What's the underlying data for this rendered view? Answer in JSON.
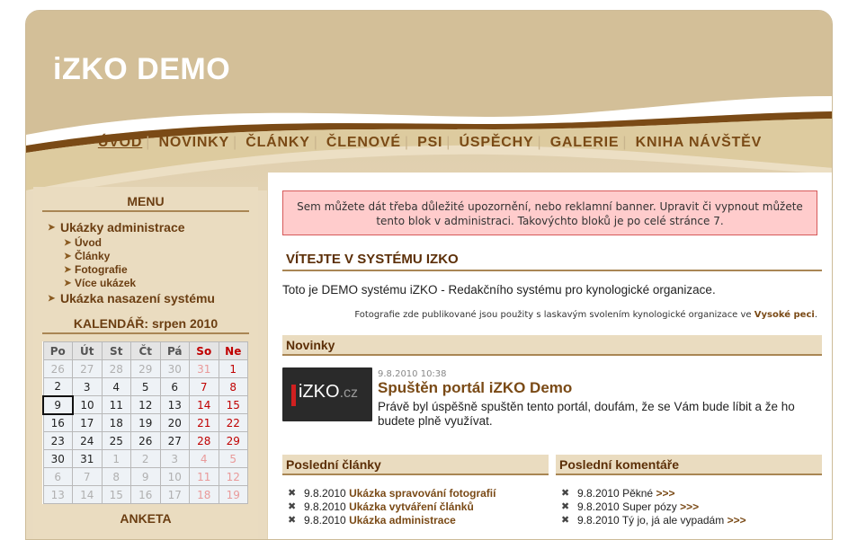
{
  "site": {
    "title": "iZKO DEMO"
  },
  "nav": [
    {
      "label": "ÚVOD",
      "active": true
    },
    {
      "label": "NOVINKY"
    },
    {
      "label": "ČLÁNKY"
    },
    {
      "label": "ČLENOVÉ"
    },
    {
      "label": "PSI"
    },
    {
      "label": "ÚSPĚCHY"
    },
    {
      "label": "GALERIE"
    },
    {
      "label": "KNIHA NÁVŠTĚV"
    }
  ],
  "sidebar": {
    "menu_heading": "MENU",
    "menu": [
      {
        "label": "Ukázky administrace",
        "children": [
          "Úvod",
          "Články",
          "Fotografie",
          "Více ukázek"
        ]
      },
      {
        "label": "Ukázka nasazení systému",
        "children": []
      }
    ],
    "calendar": {
      "heading": "KALENDÁŘ: srpen 2010",
      "days": [
        "Po",
        "Út",
        "St",
        "Čt",
        "Pá",
        "So",
        "Ne"
      ],
      "weeks": [
        [
          "26",
          "27",
          "28",
          "29",
          "30",
          "31",
          "1"
        ],
        [
          "2",
          "3",
          "4",
          "5",
          "6",
          "7",
          "8"
        ],
        [
          "9",
          "10",
          "11",
          "12",
          "13",
          "14",
          "15"
        ],
        [
          "16",
          "17",
          "18",
          "19",
          "20",
          "21",
          "22"
        ],
        [
          "23",
          "24",
          "25",
          "26",
          "27",
          "28",
          "29"
        ],
        [
          "30",
          "31",
          "1",
          "2",
          "3",
          "4",
          "5"
        ],
        [
          "6",
          "7",
          "8",
          "9",
          "10",
          "11",
          "12"
        ],
        [
          "13",
          "14",
          "15",
          "16",
          "17",
          "18",
          "19"
        ]
      ],
      "today": "9"
    },
    "poll_heading": "ANKETA"
  },
  "content": {
    "banner": "Sem můžete dát třeba důležité upozornění, nebo reklamní banner. Upravit či vypnout můžete tento blok v administraci. Takovýchto bloků je po celé stránce 7.",
    "welcome": "VÍTEJTE V SYSTÉMU IZKO",
    "intro": "Toto je DEMO systému iZKO - Redakčního systému pro kynologické organizace.",
    "credit_text": "Fotografie zde publikované jsou použity s laskavým svolením kynologické organizace ve",
    "credit_link": "Vysoké peci",
    "news": {
      "heading": "Novinky",
      "logo_main": "iZKO",
      "logo_suffix": ".cz",
      "date": "9.8.2010 10:38",
      "title": "Spuštěn portál iZKO Demo",
      "text": "Právě byl úspěšně spuštěn tento portál, doufám, že se Vám bude líbit a že ho budete plně využívat."
    },
    "articles": {
      "heading": "Poslední články",
      "items": [
        {
          "date": "9.8.2010",
          "title": "Ukázka spravování fotografií"
        },
        {
          "date": "9.8.2010",
          "title": "Ukázka vytváření článků"
        },
        {
          "date": "9.8.2010",
          "title": "Ukázka administrace"
        }
      ]
    },
    "comments": {
      "heading": "Poslední komentáře",
      "items": [
        {
          "date": "9.8.2010",
          "text": "Pěkné",
          "more": ">>>"
        },
        {
          "date": "9.8.2010",
          "text": "Super pózy",
          "more": ">>>"
        },
        {
          "date": "9.8.2010",
          "text": "Tý jo, já ale vypadám",
          "more": ">>>"
        }
      ]
    }
  }
}
